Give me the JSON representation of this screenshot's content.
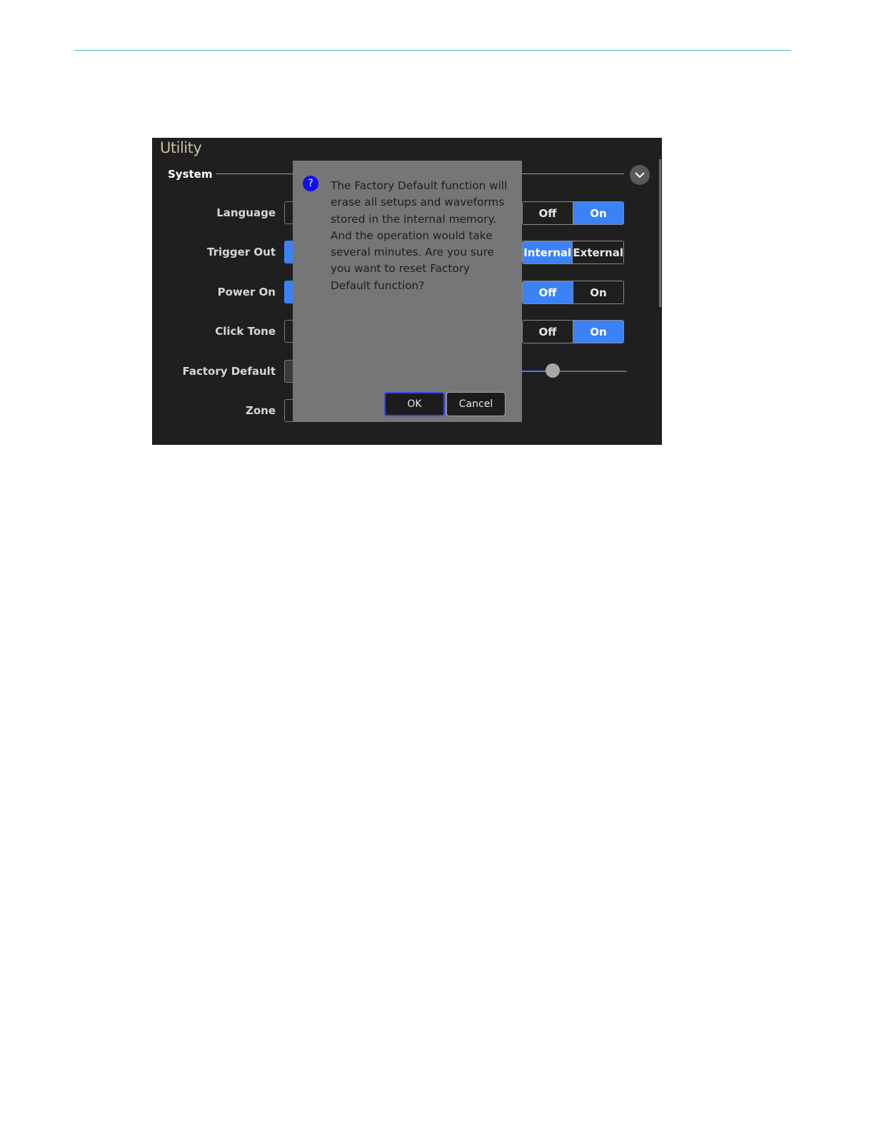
{
  "screen": {
    "title": "Utility",
    "section": "System",
    "collapse_icon": "chevron-down-icon"
  },
  "rows": [
    {
      "label": "Language"
    },
    {
      "label": "Trigger Out"
    },
    {
      "label": "Power On"
    },
    {
      "label": "Click Tone"
    },
    {
      "label": "Factory Default"
    },
    {
      "label": "Zone"
    }
  ],
  "toggles": {
    "row1": {
      "options": [
        "Off",
        "On"
      ],
      "selected": "On"
    },
    "row2": {
      "options": [
        "Internal",
        "External"
      ],
      "selected": "Internal"
    },
    "row3": {
      "options": [
        "Off",
        "On"
      ],
      "selected": "Off"
    },
    "row4": {
      "options": [
        "Off",
        "On"
      ],
      "selected": "On"
    }
  },
  "slider": {
    "value": 0.29
  },
  "dialog": {
    "icon": "question-icon",
    "icon_glyph": "?",
    "message": "The Factory Default function will erase all setups and waveforms stored in the internal memory. And the operation would take several minutes. Are you sure you want to reset Factory Default function?",
    "ok_label": "OK",
    "cancel_label": "Cancel"
  },
  "colors": {
    "accent": "#3b82f6",
    "background": "#1f1f1f",
    "dialog": "#767676",
    "title": "#cbbf9e"
  }
}
